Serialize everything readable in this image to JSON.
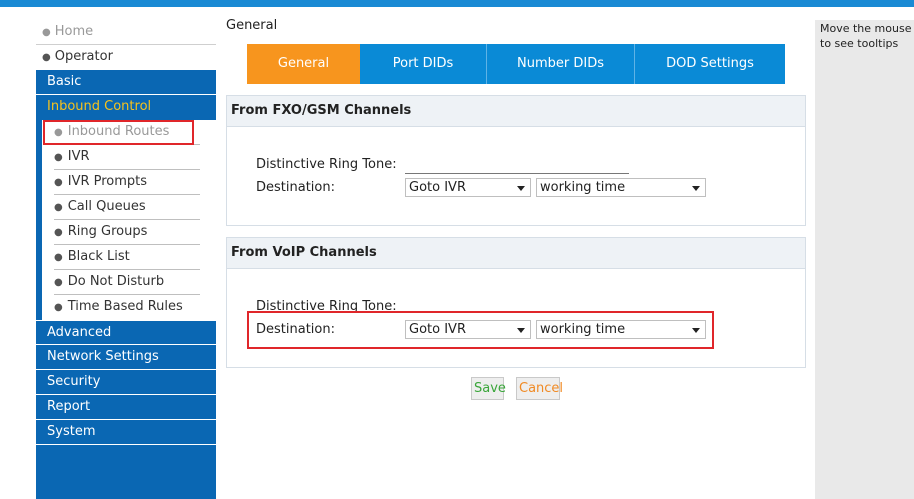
{
  "sidebar": {
    "home": "Home",
    "operator": "Operator",
    "basic": "Basic",
    "inbound_control": "Inbound Control",
    "inbound_children": [
      "Inbound Routes",
      "IVR",
      "IVR Prompts",
      "Call Queues",
      "Ring Groups",
      "Black List",
      "Do Not Disturb",
      "Time Based Rules"
    ],
    "advanced": "Advanced",
    "network_settings": "Network Settings",
    "security": "Security",
    "report": "Report",
    "system": "System"
  },
  "breadcrumb": "General",
  "tabs": [
    "General",
    "Port DIDs",
    "Number DIDs",
    "DOD Settings"
  ],
  "fxo_panel": {
    "title": "From FXO/GSM Channels",
    "ring_tone_label": "Distinctive Ring Tone:",
    "ring_tone_value": "",
    "destination_label": "Destination:",
    "destination_type": "Goto IVR",
    "destination_value": "working time"
  },
  "voip_panel": {
    "title": "From VoIP Channels",
    "ring_tone_label": "Distinctive Ring Tone:",
    "destination_label": "Destination:",
    "destination_type": "Goto IVR",
    "destination_value": "working time"
  },
  "buttons": {
    "save": "Save",
    "cancel": "Cancel"
  },
  "tips": {
    "line1": "Move the mouse",
    "line2": "to see tooltips"
  },
  "colors": {
    "accent": "#0a67b3",
    "tab_active": "#f7951e",
    "highlight": "#e0262a",
    "menu_active": "#f7c21c"
  }
}
